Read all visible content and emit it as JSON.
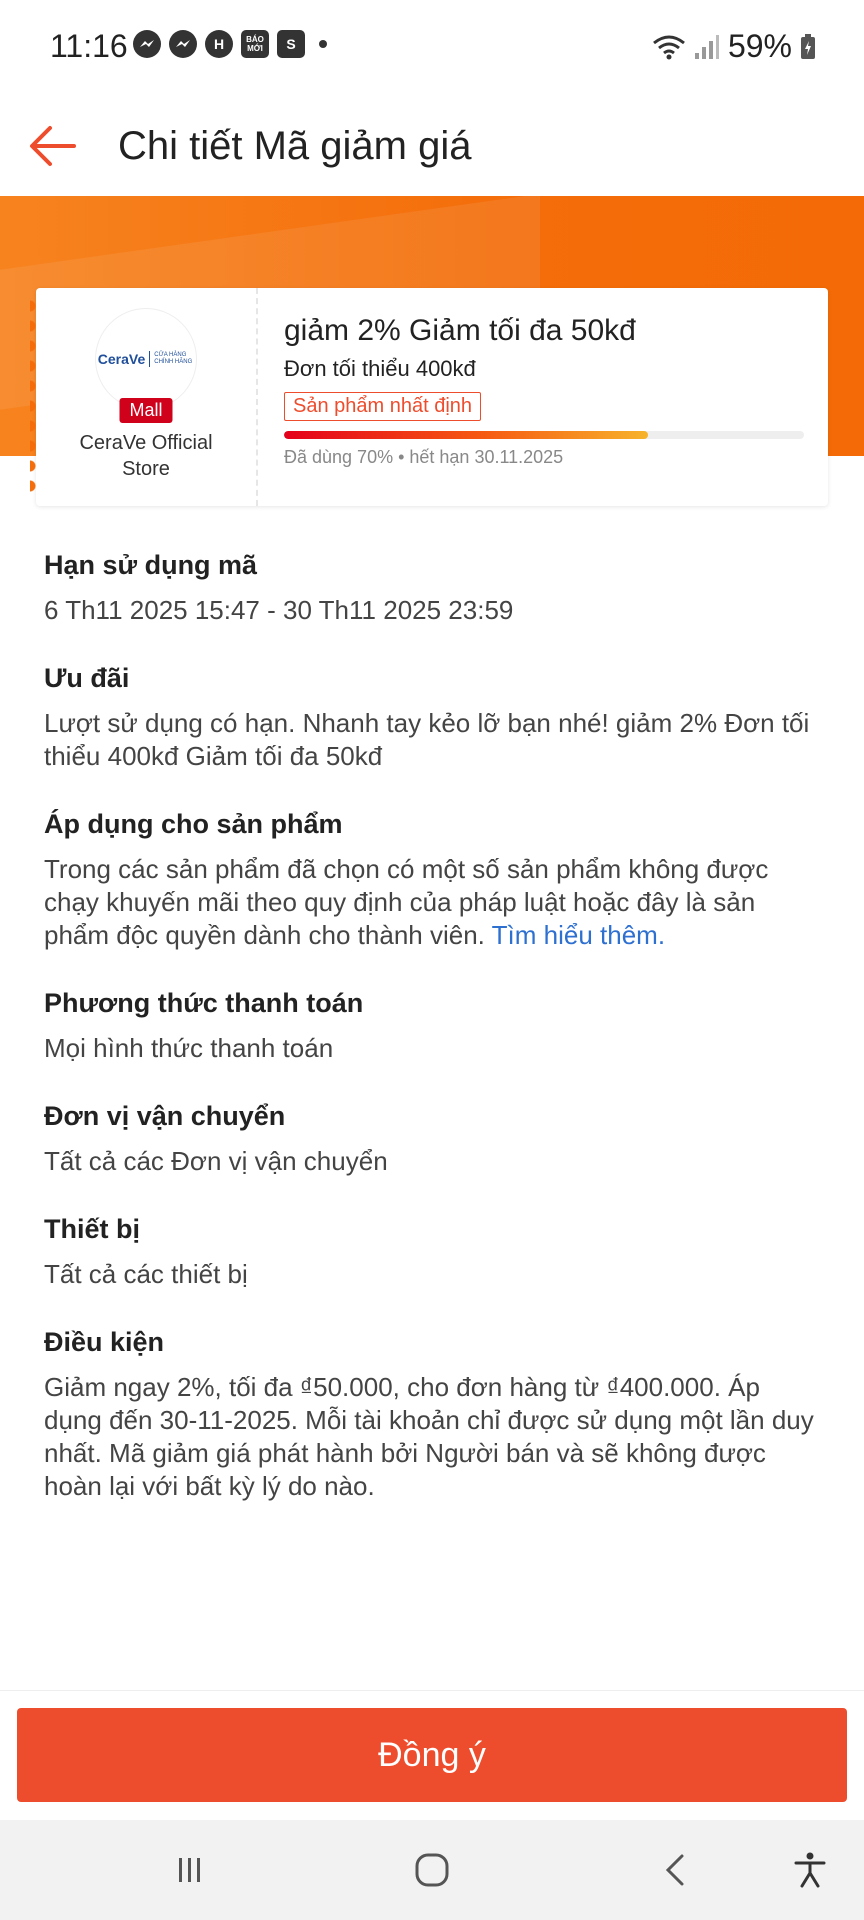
{
  "status_bar": {
    "time": "11:16",
    "battery": "59%",
    "app_icons": [
      "messenger-icon",
      "messenger-icon",
      "h-app-icon",
      "baomoi-icon",
      "shopee-icon"
    ],
    "baomoi_label": "BÁO MỚI"
  },
  "header": {
    "title": "Chi tiết Mã giảm giá"
  },
  "voucher": {
    "shop_logo_brand": "CeraVe",
    "shop_logo_sub": "CỬA HÀNG CHÍNH HÃNG",
    "mall_badge": "Mall",
    "shop_name": "CeraVe Official Store",
    "title": "giảm 2% Giảm tối đa 50kđ",
    "min_order": "Đơn tối thiểu 400kđ",
    "tag": "Sản phẩm nhất định",
    "used_fraction": 0.7,
    "usage_text": "Đã dùng 70% • hết hạn 30.11.2025"
  },
  "sections": {
    "validity": {
      "title": "Hạn sử dụng mã",
      "body": "6 Th11 2025 15:47 - 30 Th11 2025 23:59"
    },
    "offer": {
      "title": "Ưu đãi",
      "body": "Lượt sử dụng có hạn. Nhanh tay kẻo lỡ bạn nhé! giảm 2% Đơn tối thiểu 400kđ Giảm tối đa 50kđ"
    },
    "products": {
      "title": "Áp dụng cho sản phẩm",
      "body": "Trong các sản phẩm đã chọn có một số sản phẩm không được chạy khuyến mãi theo quy định của pháp luật hoặc đây là sản phẩm độc quyền dành cho thành viên.",
      "link": "Tìm hiểu thêm."
    },
    "payment": {
      "title": "Phương thức thanh toán",
      "body": "Mọi hình thức thanh toán"
    },
    "shipping": {
      "title": "Đơn vị vận chuyển",
      "body": "Tất cả các Đơn vị vận chuyển"
    },
    "device": {
      "title": "Thiết bị",
      "body": "Tất cả các thiết bị"
    },
    "conditions": {
      "title": "Điều kiện",
      "body": "Giảm ngay 2%, tối đa ₫50.000, cho đơn hàng từ ₫400.000. Áp dụng đến 30-11-2025. Mỗi tài khoản chỉ được sử dụng một lần duy nhất. Mã giảm giá phát hành bởi Người bán và sẽ không được hoàn lại với bất kỳ lý do nào."
    }
  },
  "footer": {
    "agree_label": "Đồng ý"
  },
  "colors": {
    "accent": "#ee4d2d",
    "banner": "#f46d0a",
    "link": "#2e70d0"
  }
}
